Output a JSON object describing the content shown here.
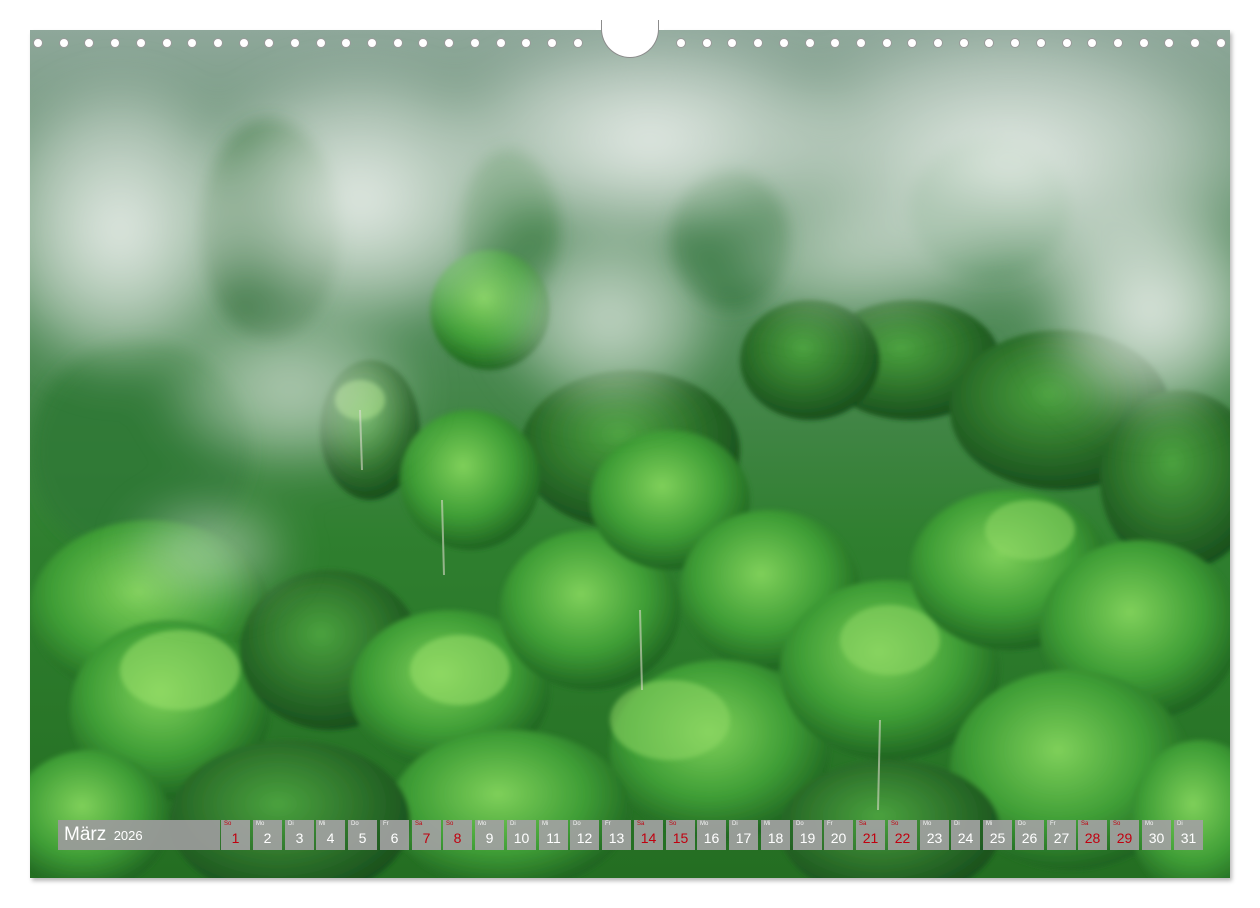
{
  "calendar": {
    "month": "März",
    "year": "2026",
    "days": [
      {
        "num": "1",
        "wd": "So",
        "kind": "sun"
      },
      {
        "num": "2",
        "wd": "Mo",
        "kind": ""
      },
      {
        "num": "3",
        "wd": "Di",
        "kind": ""
      },
      {
        "num": "4",
        "wd": "Mi",
        "kind": ""
      },
      {
        "num": "5",
        "wd": "Do",
        "kind": ""
      },
      {
        "num": "6",
        "wd": "Fr",
        "kind": ""
      },
      {
        "num": "7",
        "wd": "Sa",
        "kind": "sat"
      },
      {
        "num": "8",
        "wd": "So",
        "kind": "sun"
      },
      {
        "num": "9",
        "wd": "Mo",
        "kind": ""
      },
      {
        "num": "10",
        "wd": "Di",
        "kind": ""
      },
      {
        "num": "11",
        "wd": "Mi",
        "kind": ""
      },
      {
        "num": "12",
        "wd": "Do",
        "kind": ""
      },
      {
        "num": "13",
        "wd": "Fr",
        "kind": ""
      },
      {
        "num": "14",
        "wd": "Sa",
        "kind": "sat"
      },
      {
        "num": "15",
        "wd": "So",
        "kind": "sun"
      },
      {
        "num": "16",
        "wd": "Mo",
        "kind": ""
      },
      {
        "num": "17",
        "wd": "Di",
        "kind": ""
      },
      {
        "num": "18",
        "wd": "Mi",
        "kind": ""
      },
      {
        "num": "19",
        "wd": "Do",
        "kind": ""
      },
      {
        "num": "20",
        "wd": "Fr",
        "kind": ""
      },
      {
        "num": "21",
        "wd": "Sa",
        "kind": "sat"
      },
      {
        "num": "22",
        "wd": "So",
        "kind": "sun"
      },
      {
        "num": "23",
        "wd": "Mo",
        "kind": ""
      },
      {
        "num": "24",
        "wd": "Di",
        "kind": ""
      },
      {
        "num": "25",
        "wd": "Mi",
        "kind": ""
      },
      {
        "num": "26",
        "wd": "Do",
        "kind": ""
      },
      {
        "num": "27",
        "wd": "Fr",
        "kind": ""
      },
      {
        "num": "28",
        "wd": "Sa",
        "kind": "sat"
      },
      {
        "num": "29",
        "wd": "So",
        "kind": "sun"
      },
      {
        "num": "30",
        "wd": "Mo",
        "kind": ""
      },
      {
        "num": "31",
        "wd": "Di",
        "kind": ""
      }
    ]
  },
  "photo": {
    "subject_icon": "misty-rainforest-photo",
    "colors": {
      "canopy_dark": "#1f5f23",
      "canopy_mid": "#3f9c3a",
      "canopy_light": "#7cc95a",
      "mist": "#e6ebe8"
    }
  },
  "colors": {
    "weekend_red": "#c0000f",
    "strip_gray": "#a0a0a0"
  }
}
